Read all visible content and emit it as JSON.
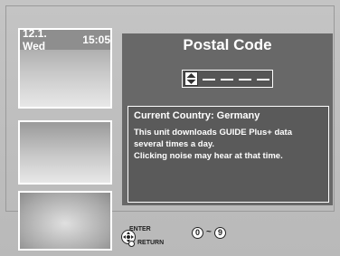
{
  "date_time": {
    "date": "12.1. Wed",
    "time": "15:05"
  },
  "dialog": {
    "title": "Postal Code",
    "postal_code_value": "",
    "info_title": "Current Country: Germany",
    "info_line1": "This unit downloads GUIDE Plus+ data several times a day.",
    "info_line2": "Clicking noise may hear at that time."
  },
  "help_bar": {
    "enter_label": "ENTER",
    "return_label": "RETURN",
    "range_start": "0",
    "range_sep": "~",
    "range_end": "9"
  },
  "icons": {
    "spinner": "up-down-arrows-icon",
    "dpad": "directional-pad-icon",
    "return": "return-circle-icon"
  }
}
